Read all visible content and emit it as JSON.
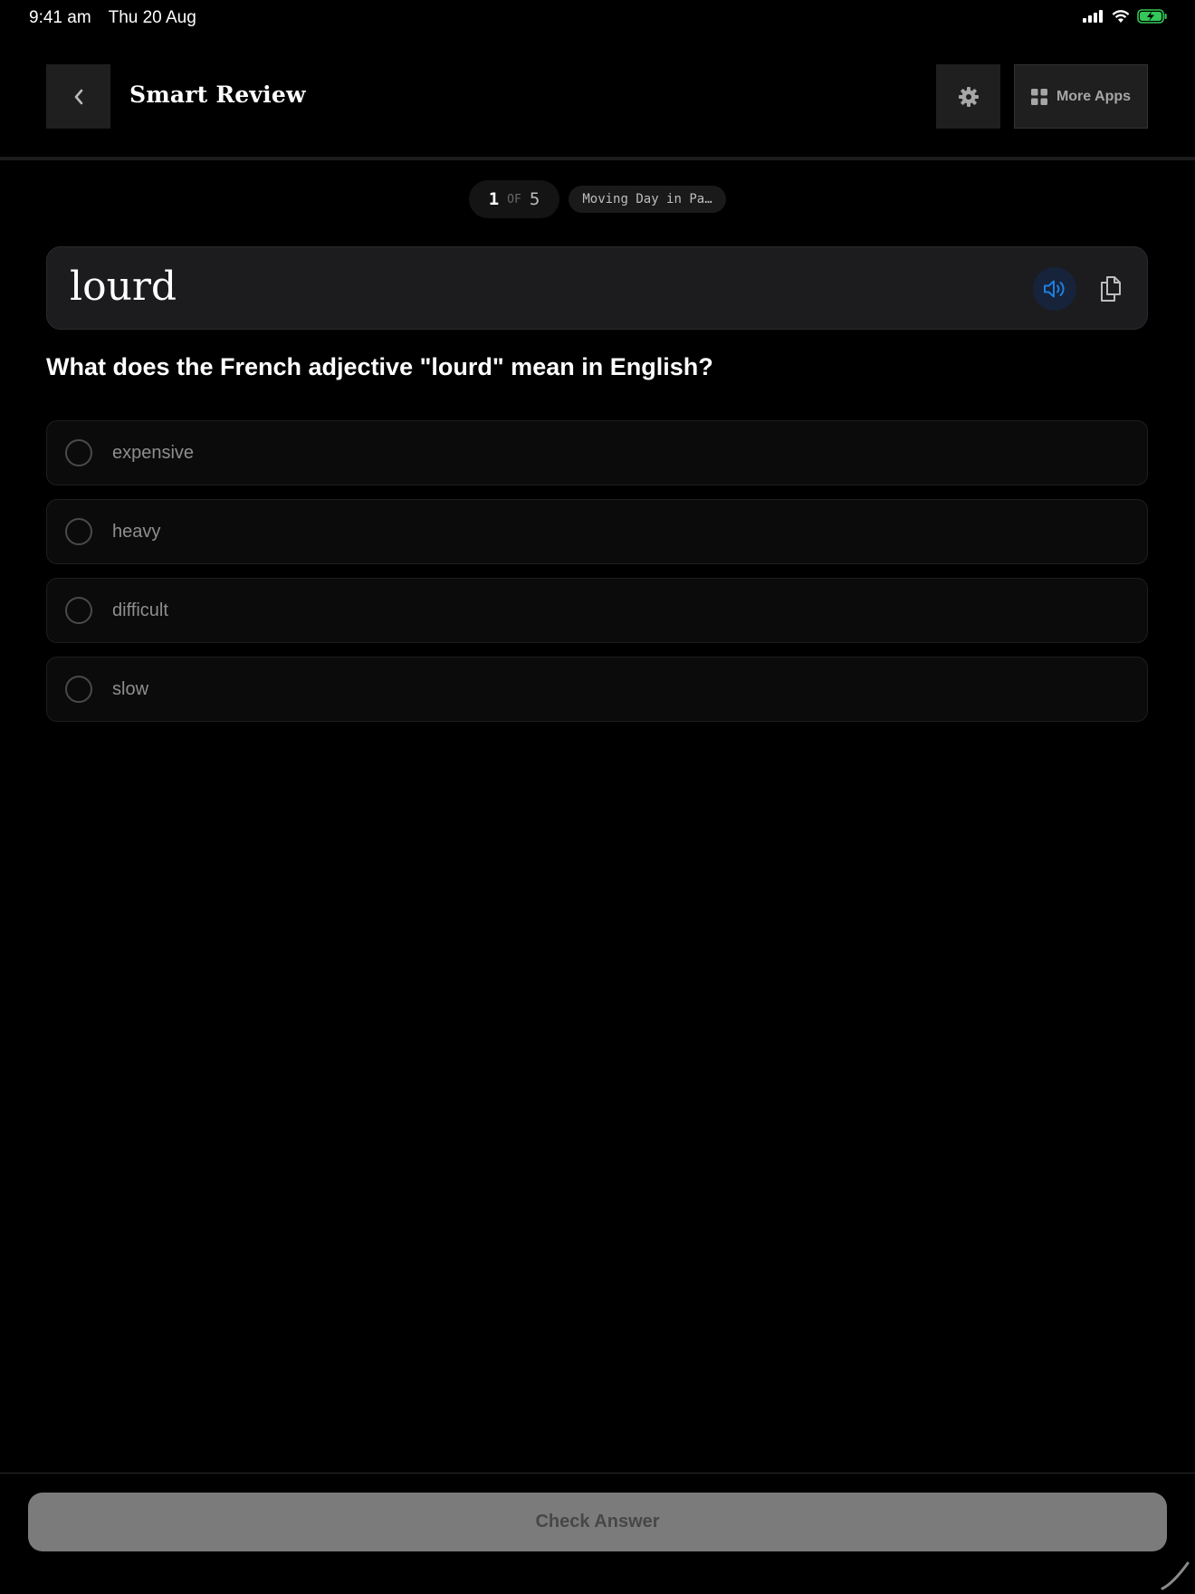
{
  "status_bar": {
    "time": "9:41 am",
    "date": "Thu 20 Aug",
    "icons": [
      "signal-icon",
      "wifi-icon",
      "battery-charging-icon"
    ],
    "battery_color": "#34c759"
  },
  "header": {
    "back_icon": "chevron-left-icon",
    "title": "Smart Review",
    "settings_icon": "gear-icon",
    "more_apps_icon": "grid-icon",
    "more_apps_label": "More Apps"
  },
  "progress": {
    "current": "1",
    "of_label": "OF",
    "total": "5",
    "topic": "Moving Day in Pa…"
  },
  "word_card": {
    "word": "lourd",
    "speaker_icon": "speaker-icon",
    "copy_icon": "copy-icon",
    "accent_color": "#1e7fe0"
  },
  "question": "What does the French adjective \"lourd\" mean in English?",
  "options": [
    {
      "label": "expensive"
    },
    {
      "label": "heavy"
    },
    {
      "label": "difficult"
    },
    {
      "label": "slow"
    }
  ],
  "footer": {
    "check_label": "Check Answer"
  }
}
